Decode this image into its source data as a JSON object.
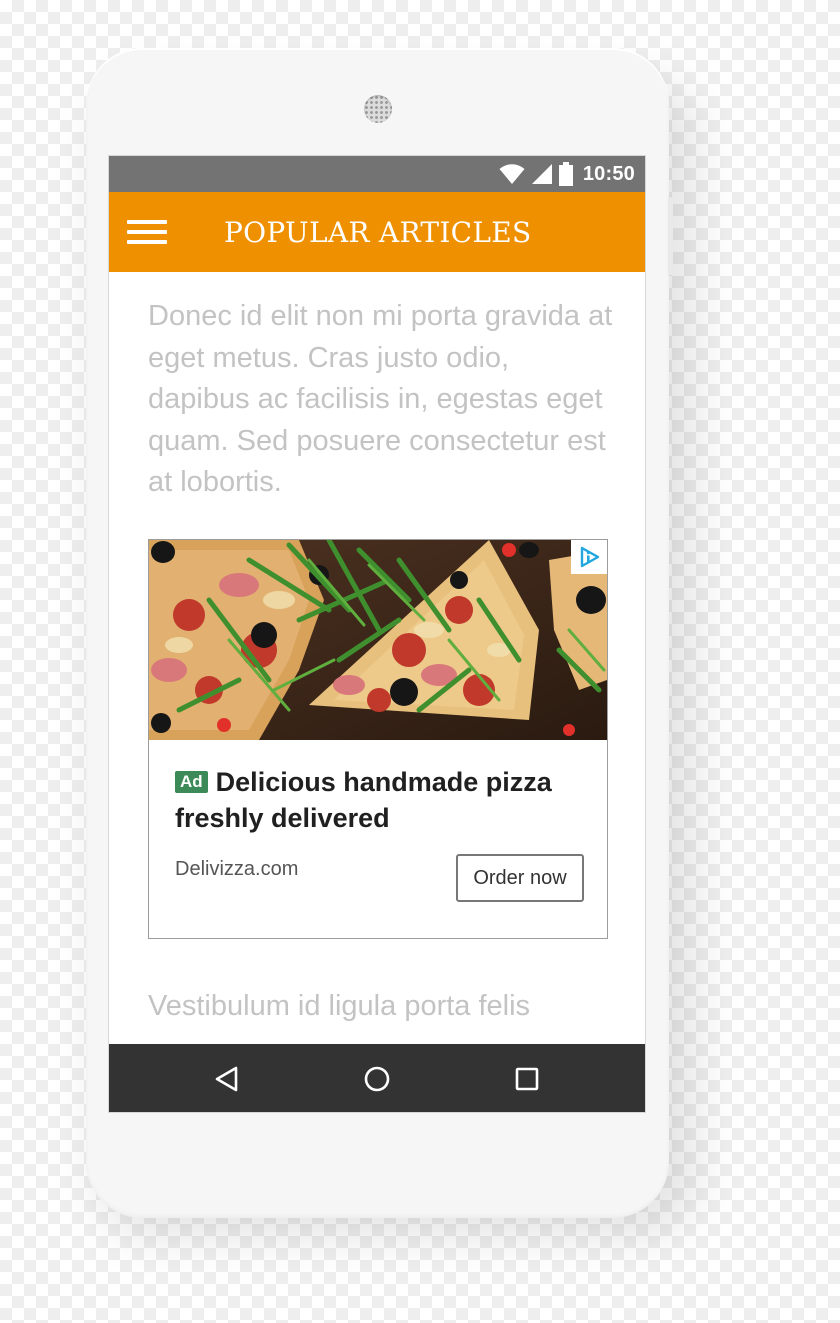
{
  "status_bar": {
    "time": "10:50"
  },
  "app_bar": {
    "title": "POPULAR ARTICLES"
  },
  "article": {
    "paragraph_1": "Donec id elit non mi porta gravida at eget metus. Cras justo odio, dapibus ac facilisis in, egestas eget quam. Sed posuere consectetur est at lobortis.",
    "paragraph_2": "Vestibulum id ligula porta felis"
  },
  "ad": {
    "badge": "Ad",
    "headline": "Delicious handmade pizza freshly delivered",
    "domain": "Delivizza.com",
    "cta": "Order now"
  },
  "icons": {
    "menu": "hamburger-menu-icon",
    "wifi": "wifi-icon",
    "signal": "cell-signal-icon",
    "battery": "battery-icon",
    "ad_choices": "adchoices-icon",
    "back": "back-triangle-icon",
    "home": "home-circle-icon",
    "recents": "recents-square-icon"
  },
  "colors": {
    "app_bar": "#ef9000",
    "status_bar": "#737373",
    "nav_bar": "#333333",
    "body_text": "#c3c3c3",
    "ad_badge": "#3b8a57",
    "ad_choices": "#21a7de"
  }
}
